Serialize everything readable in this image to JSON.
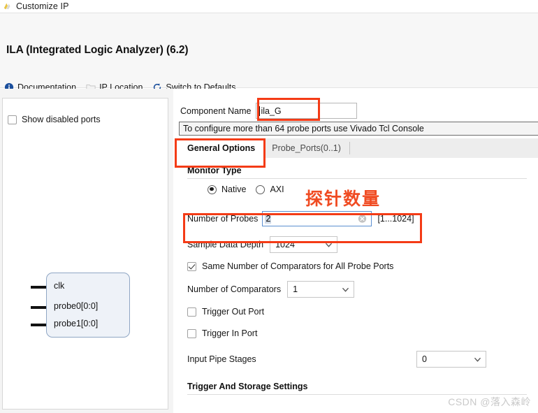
{
  "window": {
    "title": "Customize IP",
    "icon": "vivado-ip-icon"
  },
  "header": {
    "ip_title": "ILA (Integrated Logic Analyzer) (6.2)",
    "links": [
      {
        "label": "Documentation",
        "icon": "info-circle-icon"
      },
      {
        "label": "IP Location",
        "icon": "folder-icon"
      },
      {
        "label": "Switch to Defaults",
        "icon": "refresh-icon"
      }
    ]
  },
  "left_panel": {
    "show_disabled_ports": {
      "label": "Show disabled ports",
      "checked": false
    },
    "symbol": {
      "ports": [
        "clk",
        "probe0[0:0]",
        "probe1[0:0]"
      ]
    }
  },
  "right_panel": {
    "component_name": {
      "label": "Component Name",
      "value": "ila_G"
    },
    "info_message": "To configure more than 64 probe ports use Vivado Tcl Console",
    "tabs": [
      {
        "label": "General Options",
        "active": true
      },
      {
        "label": "Probe_Ports(0..1)",
        "active": false
      }
    ],
    "monitor_type": {
      "section_label": "Monitor Type",
      "options": [
        {
          "label": "Native",
          "selected": true
        },
        {
          "label": "AXI",
          "selected": false
        }
      ]
    },
    "number_of_probes": {
      "label": "Number of Probes",
      "value": "2",
      "range_hint": "[1...1024]",
      "clear_icon": "clear-circle-icon"
    },
    "sample_data_depth": {
      "label": "Sample Data Depth",
      "value": "1024"
    },
    "same_comparators": {
      "label": "Same Number of Comparators for All Probe Ports",
      "checked": true
    },
    "number_of_comparators": {
      "label": "Number of Comparators",
      "value": "1"
    },
    "trigger_out_port": {
      "label": "Trigger Out Port",
      "checked": false
    },
    "trigger_in_port": {
      "label": "Trigger In Port",
      "checked": false
    },
    "input_pipe_stages": {
      "label": "Input Pipe Stages",
      "value": "0"
    },
    "trigger_storage_settings": {
      "label": "Trigger And Storage Settings"
    }
  },
  "annotations": {
    "callout_text": "探针数量",
    "color": "#f43b16"
  },
  "watermark": {
    "text": "CSDN @落入森岭"
  }
}
